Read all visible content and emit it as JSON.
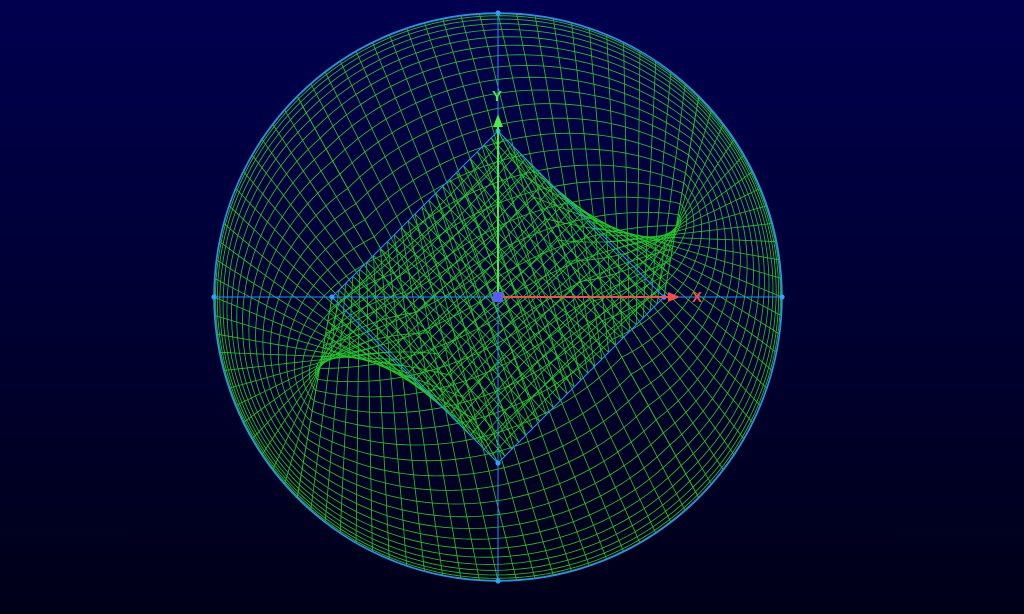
{
  "viewport": {
    "background_top": "#00004f",
    "background_bottom": "#000018"
  },
  "mesh": {
    "shape": "o-grid circular mesh",
    "line_color": "#22cc22",
    "block_edge_color": "#2a8cff",
    "vertex_color": "#2aa0ff",
    "core_cells": 24,
    "radial_cells": 26
  },
  "axes": {
    "x": {
      "label": "X",
      "color": "#ff4a4a"
    },
    "y": {
      "label": "Y",
      "color": "#44ee44"
    },
    "origin_marker_color": "#5a5aff"
  }
}
